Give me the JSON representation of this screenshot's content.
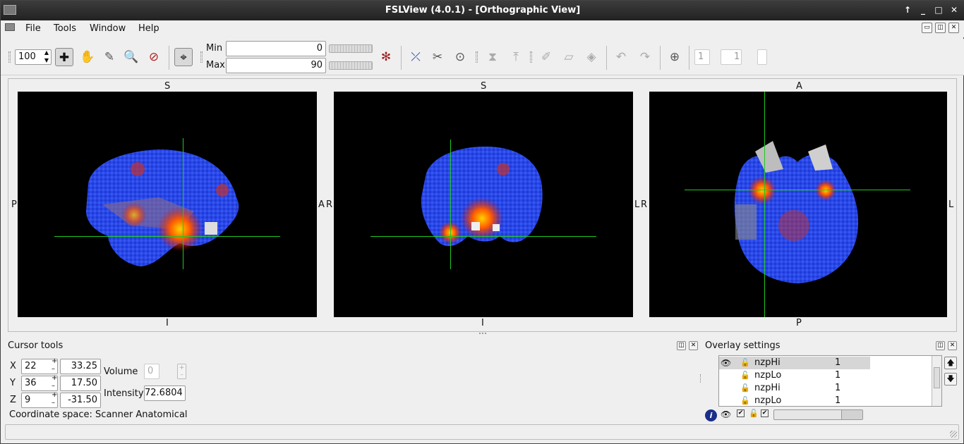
{
  "window": {
    "title": "FSLView (4.0.1) - [Orthographic View]"
  },
  "menu": {
    "items": [
      "File",
      "Tools",
      "Window",
      "Help"
    ]
  },
  "toolbar": {
    "zoom": "100",
    "min_label": "Min",
    "min_value": "0",
    "max_label": "Max",
    "max_value": "90",
    "slice_a": "1",
    "slice_b": "1"
  },
  "views": [
    {
      "top": "S",
      "bottom": "I",
      "left": "P",
      "right": "A"
    },
    {
      "top": "S",
      "bottom": "I",
      "left": "R",
      "right": "L"
    },
    {
      "top": "A",
      "bottom": "P",
      "left": "R",
      "right": "L"
    }
  ],
  "cursor_tools": {
    "title": "Cursor tools",
    "x_label": "X",
    "x_voxel": "22",
    "x_mm": "33.25",
    "y_label": "Y",
    "y_voxel": "36",
    "y_mm": "17.50",
    "z_label": "Z",
    "z_voxel": "9",
    "z_mm": "-31.50",
    "volume_label": "Volume",
    "volume_value": "0",
    "intensity_label": "Intensity",
    "intensity_value": "72.6804",
    "coord_space": "Coordinate space: Scanner Anatomical"
  },
  "overlay": {
    "title": "Overlay settings",
    "rows": [
      {
        "name": "nzpHi",
        "value": "1",
        "visible": true
      },
      {
        "name": "nzpLo",
        "value": "1",
        "visible": false
      },
      {
        "name": "nzpHi",
        "value": "1",
        "visible": false
      },
      {
        "name": "nzpLo",
        "value": "1",
        "visible": false
      }
    ]
  }
}
